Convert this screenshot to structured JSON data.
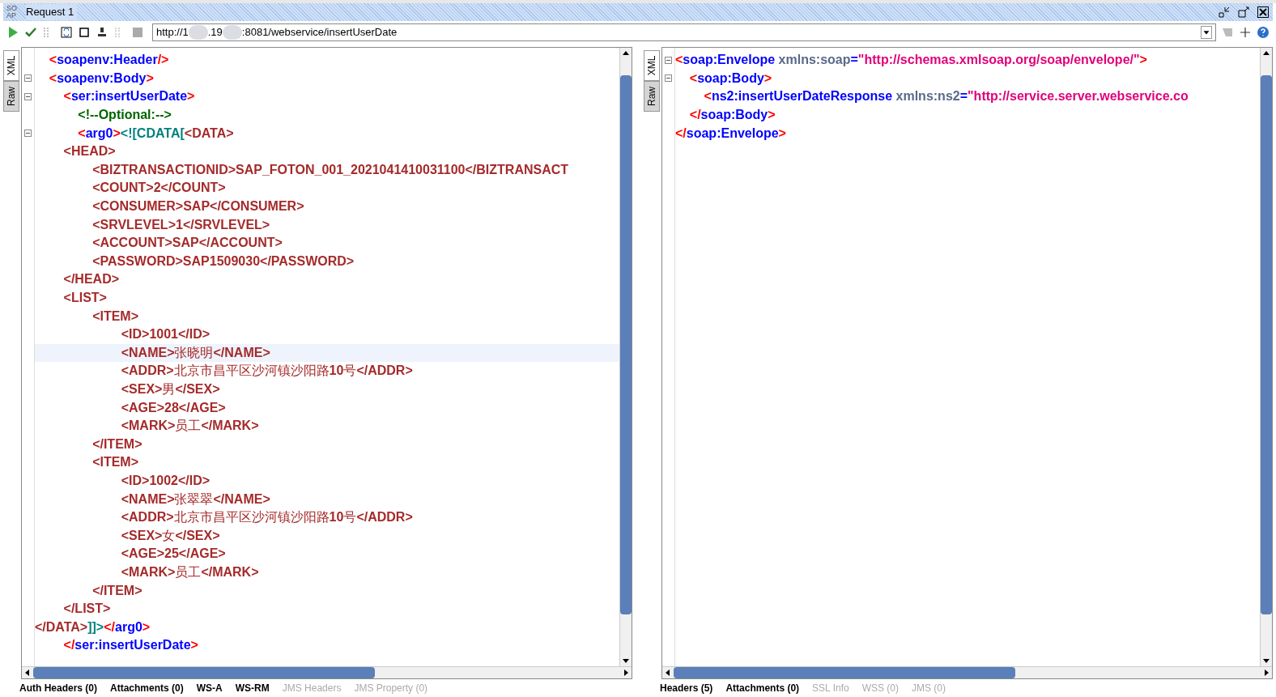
{
  "window": {
    "title": "Request 1",
    "badge": "SO AP"
  },
  "toolbar": {
    "url_parts": [
      "http://1",
      ".19",
      ":8081/webservice/insertUserDate"
    ]
  },
  "request": {
    "side_tabs": [
      {
        "label": "XML",
        "selected": true
      },
      {
        "label": "Raw",
        "selected": false
      }
    ],
    "lines": [
      {
        "fold": false,
        "highlighted": false,
        "segs": [
          {
            "kind": "p",
            "text": "    <"
          },
          {
            "kind": "t",
            "text": "soapenv:Header"
          },
          {
            "kind": "p",
            "text": "/>"
          }
        ]
      },
      {
        "fold": true,
        "highlighted": false,
        "segs": [
          {
            "kind": "p",
            "text": "    <"
          },
          {
            "kind": "t",
            "text": "soapenv:Body"
          },
          {
            "kind": "p",
            "text": ">"
          }
        ]
      },
      {
        "fold": true,
        "highlighted": false,
        "segs": [
          {
            "kind": "p",
            "text": "        <"
          },
          {
            "kind": "t",
            "text": "ser:insertUserDate"
          },
          {
            "kind": "p",
            "text": ">"
          }
        ]
      },
      {
        "fold": false,
        "highlighted": false,
        "segs": [
          {
            "kind": "c",
            "text": "            <!--Optional:-->"
          }
        ]
      },
      {
        "fold": true,
        "highlighted": false,
        "segs": [
          {
            "kind": "p",
            "text": "            <"
          },
          {
            "kind": "t",
            "text": "arg0"
          },
          {
            "kind": "p",
            "text": ">"
          },
          {
            "kind": "x",
            "text": "<![CDATA["
          },
          {
            "kind": "d",
            "text": "<DATA>"
          }
        ]
      },
      {
        "fold": false,
        "highlighted": false,
        "segs": [
          {
            "kind": "d",
            "text": "        <HEAD>"
          }
        ]
      },
      {
        "fold": false,
        "highlighted": false,
        "segs": [
          {
            "kind": "d",
            "text": "                <BIZTRANSACTIONID>SAP_FOTON_001_2021041410031100</BIZTRANSACT"
          }
        ]
      },
      {
        "fold": false,
        "highlighted": false,
        "segs": [
          {
            "kind": "d",
            "text": "                <COUNT>2</COUNT>"
          }
        ]
      },
      {
        "fold": false,
        "highlighted": false,
        "segs": [
          {
            "kind": "d",
            "text": "                <CONSUMER>SAP</CONSUMER>"
          }
        ]
      },
      {
        "fold": false,
        "highlighted": false,
        "segs": [
          {
            "kind": "d",
            "text": "                <SRVLEVEL>1</SRVLEVEL>"
          }
        ]
      },
      {
        "fold": false,
        "highlighted": false,
        "segs": [
          {
            "kind": "d",
            "text": "                <ACCOUNT>SAP</ACCOUNT>"
          }
        ]
      },
      {
        "fold": false,
        "highlighted": false,
        "segs": [
          {
            "kind": "d",
            "text": "                <PASSWORD>SAP1509030</PASSWORD>"
          }
        ]
      },
      {
        "fold": false,
        "highlighted": false,
        "segs": [
          {
            "kind": "d",
            "text": "        </HEAD>"
          }
        ]
      },
      {
        "fold": false,
        "highlighted": false,
        "segs": [
          {
            "kind": "d",
            "text": "        <LIST>"
          }
        ]
      },
      {
        "fold": false,
        "highlighted": false,
        "segs": [
          {
            "kind": "d",
            "text": "                <ITEM>"
          }
        ]
      },
      {
        "fold": false,
        "highlighted": false,
        "segs": [
          {
            "kind": "d",
            "text": "                        <ID>1001</ID>"
          }
        ]
      },
      {
        "fold": false,
        "highlighted": true,
        "segs": [
          {
            "kind": "d",
            "text": "                        <NAME>"
          },
          {
            "kind": "z",
            "text": "张晓明"
          },
          {
            "kind": "d",
            "text": "</NAME>"
          }
        ]
      },
      {
        "fold": false,
        "highlighted": false,
        "segs": [
          {
            "kind": "d",
            "text": "                        <ADDR>"
          },
          {
            "kind": "z",
            "text": "北京市昌平区沙河镇沙阳路"
          },
          {
            "kind": "d",
            "text": "10"
          },
          {
            "kind": "z",
            "text": "号"
          },
          {
            "kind": "d",
            "text": "</ADDR>"
          }
        ]
      },
      {
        "fold": false,
        "highlighted": false,
        "segs": [
          {
            "kind": "d",
            "text": "                        <SEX>"
          },
          {
            "kind": "z",
            "text": "男"
          },
          {
            "kind": "d",
            "text": "</SEX>"
          }
        ]
      },
      {
        "fold": false,
        "highlighted": false,
        "segs": [
          {
            "kind": "d",
            "text": "                        <AGE>28</AGE>"
          }
        ]
      },
      {
        "fold": false,
        "highlighted": false,
        "segs": [
          {
            "kind": "d",
            "text": "                        <MARK>"
          },
          {
            "kind": "z",
            "text": "员工"
          },
          {
            "kind": "d",
            "text": "</MARK>"
          }
        ]
      },
      {
        "fold": false,
        "highlighted": false,
        "segs": [
          {
            "kind": "d",
            "text": "                </ITEM>"
          }
        ]
      },
      {
        "fold": false,
        "highlighted": false,
        "segs": [
          {
            "kind": "d",
            "text": "                <ITEM>"
          }
        ]
      },
      {
        "fold": false,
        "highlighted": false,
        "segs": [
          {
            "kind": "d",
            "text": "                        <ID>1002</ID>"
          }
        ]
      },
      {
        "fold": false,
        "highlighted": false,
        "segs": [
          {
            "kind": "d",
            "text": "                        <NAME>"
          },
          {
            "kind": "z",
            "text": "张翠翠"
          },
          {
            "kind": "d",
            "text": "</NAME>"
          }
        ]
      },
      {
        "fold": false,
        "highlighted": false,
        "segs": [
          {
            "kind": "d",
            "text": "                        <ADDR>"
          },
          {
            "kind": "z",
            "text": "北京市昌平区沙河镇沙阳路"
          },
          {
            "kind": "d",
            "text": "10"
          },
          {
            "kind": "z",
            "text": "号"
          },
          {
            "kind": "d",
            "text": "</ADDR>"
          }
        ]
      },
      {
        "fold": false,
        "highlighted": false,
        "segs": [
          {
            "kind": "d",
            "text": "                        <SEX>"
          },
          {
            "kind": "z",
            "text": "女"
          },
          {
            "kind": "d",
            "text": "</SEX>"
          }
        ]
      },
      {
        "fold": false,
        "highlighted": false,
        "segs": [
          {
            "kind": "d",
            "text": "                        <AGE>25</AGE>"
          }
        ]
      },
      {
        "fold": false,
        "highlighted": false,
        "segs": [
          {
            "kind": "d",
            "text": "                        <MARK>"
          },
          {
            "kind": "z",
            "text": "员工"
          },
          {
            "kind": "d",
            "text": "</MARK>"
          }
        ]
      },
      {
        "fold": false,
        "highlighted": false,
        "segs": [
          {
            "kind": "d",
            "text": "                </ITEM>"
          }
        ]
      },
      {
        "fold": false,
        "highlighted": false,
        "segs": [
          {
            "kind": "d",
            "text": "        </LIST>"
          }
        ]
      },
      {
        "fold": false,
        "highlighted": false,
        "segs": [
          {
            "kind": "d",
            "text": "</DATA>"
          },
          {
            "kind": "x",
            "text": "]]>"
          },
          {
            "kind": "p",
            "text": "</"
          },
          {
            "kind": "t",
            "text": "arg0"
          },
          {
            "kind": "p",
            "text": ">"
          }
        ]
      },
      {
        "fold": false,
        "highlighted": false,
        "segs": [
          {
            "kind": "p",
            "text": "        </"
          },
          {
            "kind": "t",
            "text": "ser:insertUserDate"
          },
          {
            "kind": "p",
            "text": ">"
          }
        ]
      }
    ],
    "bottom_tabs": [
      {
        "label": "Auth Headers (0)",
        "disabled": false
      },
      {
        "label": "Attachments (0)",
        "disabled": false
      },
      {
        "label": "WS-A",
        "disabled": false
      },
      {
        "label": "WS-RM",
        "disabled": false
      },
      {
        "label": "JMS Headers",
        "disabled": true
      },
      {
        "label": "JMS Property (0)",
        "disabled": true
      }
    ]
  },
  "response": {
    "side_tabs": [
      {
        "label": "XML",
        "selected": true
      },
      {
        "label": "Raw",
        "selected": false
      }
    ],
    "lines": [
      {
        "fold": true,
        "highlighted": false,
        "segs": [
          {
            "kind": "p",
            "text": "<"
          },
          {
            "kind": "t",
            "text": "soap:Envelope "
          },
          {
            "kind": "a",
            "text": "xmlns:soap"
          },
          {
            "kind": "t",
            "text": "="
          },
          {
            "kind": "v",
            "text": "\"http://schemas.xmlsoap.org/soap/envelope/\""
          },
          {
            "kind": "p",
            "text": ">"
          }
        ]
      },
      {
        "fold": true,
        "highlighted": false,
        "segs": [
          {
            "kind": "p",
            "text": "    <"
          },
          {
            "kind": "t",
            "text": "soap:Body"
          },
          {
            "kind": "p",
            "text": ">"
          }
        ]
      },
      {
        "fold": false,
        "highlighted": false,
        "segs": [
          {
            "kind": "p",
            "text": "        <"
          },
          {
            "kind": "t",
            "text": "ns2:insertUserDateResponse "
          },
          {
            "kind": "a",
            "text": "xmlns:ns2"
          },
          {
            "kind": "t",
            "text": "="
          },
          {
            "kind": "v",
            "text": "\"http://service.server.webservice.co"
          }
        ]
      },
      {
        "fold": false,
        "highlighted": false,
        "segs": [
          {
            "kind": "p",
            "text": "    </"
          },
          {
            "kind": "t",
            "text": "soap:Body"
          },
          {
            "kind": "p",
            "text": ">"
          }
        ]
      },
      {
        "fold": false,
        "highlighted": false,
        "segs": [
          {
            "kind": "p",
            "text": "</"
          },
          {
            "kind": "t",
            "text": "soap:Envelope"
          },
          {
            "kind": "p",
            "text": ">"
          }
        ]
      }
    ],
    "bottom_tabs": [
      {
        "label": "Headers (5)",
        "disabled": false
      },
      {
        "label": "Attachments (0)",
        "disabled": false
      },
      {
        "label": "SSL Info",
        "disabled": true
      },
      {
        "label": "WSS (0)",
        "disabled": true
      },
      {
        "label": "JMS (0)",
        "disabled": true
      }
    ]
  }
}
